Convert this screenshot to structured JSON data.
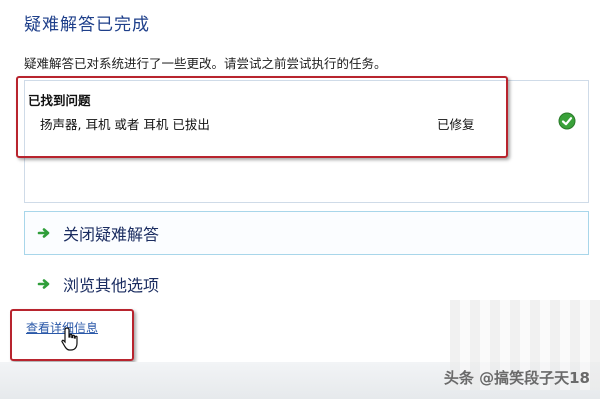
{
  "header": {
    "title": "疑难解答已完成",
    "subtitle": "疑难解答已对系统进行了一些更改。请尝试之前尝试执行的任务。"
  },
  "problems": {
    "heading": "已找到问题",
    "items": [
      {
        "label": "扬声器, 耳机 或者 耳机 已拔出",
        "status": "已修复",
        "status_icon": "check-circle-icon"
      }
    ]
  },
  "actions": {
    "close_label": "关闭疑难解答",
    "explore_label": "浏览其他选项",
    "details_link": "查看详细信息"
  },
  "watermark": "头条 @搞笑段子天18",
  "colors": {
    "title": "#1e3f8a",
    "highlight": "#b8242e",
    "arrow": "#2f9e3a",
    "link": "#2a58a8"
  }
}
